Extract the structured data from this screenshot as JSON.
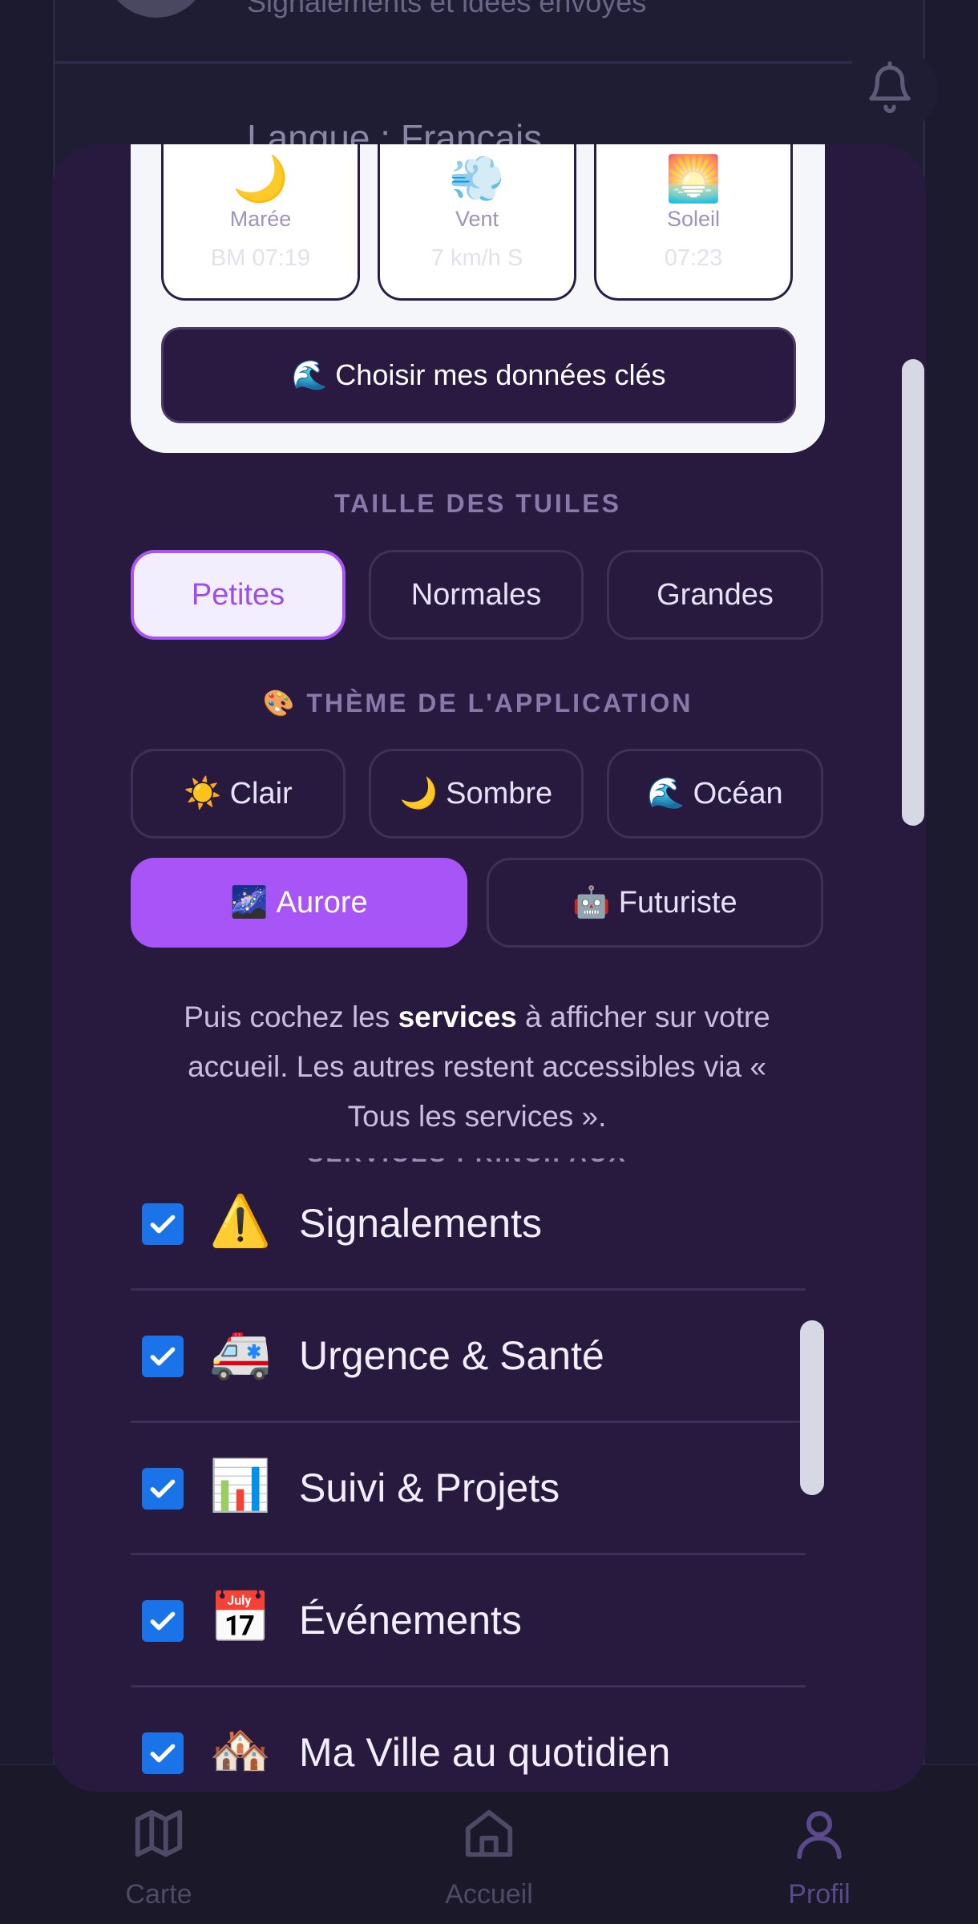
{
  "background": {
    "subtitle": "Signalements et idées envoyés",
    "language": "Langue : Français"
  },
  "weather": {
    "tiles": [
      {
        "icon": "🌙",
        "label": "Marée",
        "value": "BM 07:19"
      },
      {
        "icon": "💨",
        "label": "Vent",
        "value": "7 km/h S"
      },
      {
        "icon": "🌅",
        "label": "Soleil",
        "value": "07:23"
      }
    ],
    "choose_button": "🌊 Choisir mes données clés"
  },
  "tile_size": {
    "title": "TAILLE DES TUILES",
    "options": [
      "Petites",
      "Normales",
      "Grandes"
    ],
    "selected": "Petites"
  },
  "theme": {
    "title": "🎨 THÈME DE L'APPLICATION",
    "options": [
      {
        "emoji": "☀️",
        "label": "Clair"
      },
      {
        "emoji": "🌙",
        "label": "Sombre"
      },
      {
        "emoji": "🌊",
        "label": "Océan"
      },
      {
        "emoji": "🌌",
        "label": "Aurore"
      },
      {
        "emoji": "🤖",
        "label": "Futuriste"
      }
    ],
    "selected": "Aurore"
  },
  "help": {
    "before": "Puis cochez les ",
    "bold": "services",
    "after": " à afficher sur votre accueil. Les autres restent accessibles via « Tous les services »."
  },
  "services": {
    "header": "SERVICES PRINCIPAUX",
    "items": [
      {
        "emoji": "⚠️",
        "label": "Signalements",
        "checked": true
      },
      {
        "emoji": "🚑",
        "label": "Urgence & Santé",
        "checked": true
      },
      {
        "emoji": "📊",
        "label": "Suivi & Projets",
        "checked": true
      },
      {
        "emoji": "📅",
        "label": "Événements",
        "checked": true
      },
      {
        "emoji": "🏘️",
        "label": "Ma Ville au quotidien",
        "checked": true
      }
    ]
  },
  "nav": {
    "items": [
      {
        "label": "Carte",
        "icon": "map-icon"
      },
      {
        "label": "Accueil",
        "icon": "home-icon"
      },
      {
        "label": "Profil",
        "icon": "user-icon"
      }
    ],
    "active": "Profil"
  },
  "colors": {
    "accent": "#a855f7",
    "sheet": "#28193f",
    "checkbox": "#1a73e8"
  }
}
